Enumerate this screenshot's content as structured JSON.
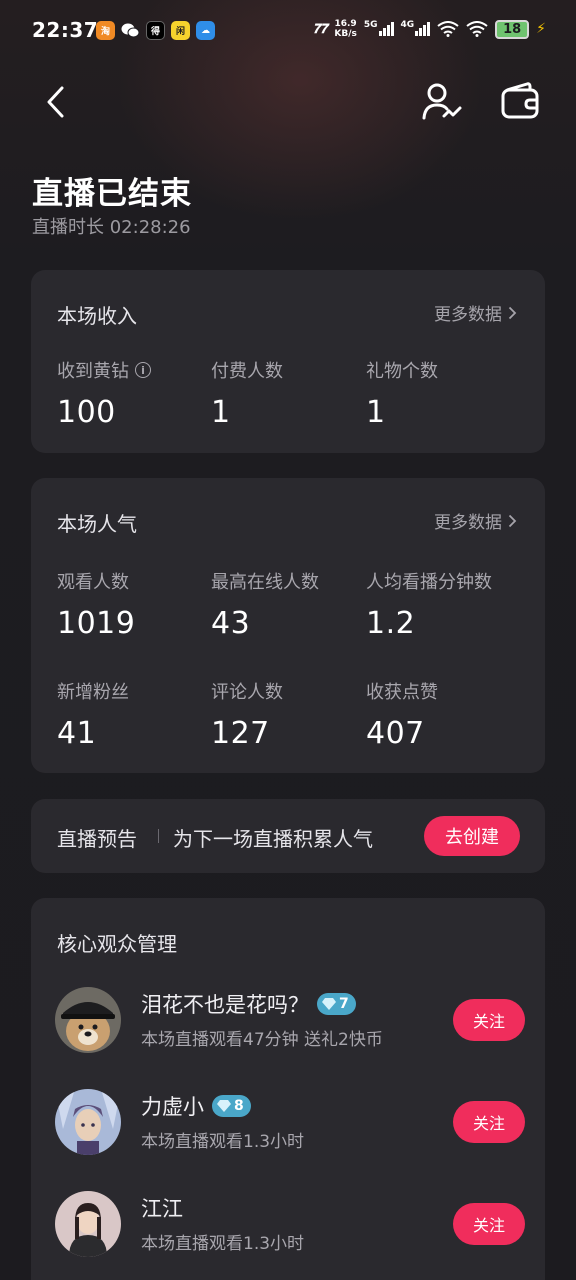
{
  "status_bar": {
    "time": "22:37",
    "net_speed_value": "16.9",
    "net_speed_unit": "KB/s",
    "sim1": "5G",
    "sim2": "4G",
    "battery": "18"
  },
  "header": {
    "title": "直播已结束",
    "duration": "直播时长 02:28:26"
  },
  "income": {
    "title": "本场收入",
    "more": "更多数据",
    "stats": [
      {
        "label": "收到黄钻",
        "value": "100"
      },
      {
        "label": "付费人数",
        "value": "1"
      },
      {
        "label": "礼物个数",
        "value": "1"
      }
    ]
  },
  "popularity": {
    "title": "本场人气",
    "more": "更多数据",
    "stats": [
      {
        "label": "观看人数",
        "value": "1019"
      },
      {
        "label": "最高在线人数",
        "value": "43"
      },
      {
        "label": "人均看播分钟数",
        "value": "1.2"
      },
      {
        "label": "新增粉丝",
        "value": "41"
      },
      {
        "label": "评论人数",
        "value": "127"
      },
      {
        "label": "收获点赞",
        "value": "407"
      }
    ]
  },
  "preview": {
    "label": "直播预告",
    "description": "为下一场直播积累人气",
    "button": "去创建"
  },
  "audience": {
    "title": "核心观众管理",
    "items": [
      {
        "name": "泪花不也是花吗？",
        "level": "7",
        "desc": "本场直播观看47分钟 送礼2快币",
        "follow": "关注"
      },
      {
        "name": "力虚小",
        "level": "8",
        "desc": "本场直播观看1.3小时",
        "follow": "关注"
      },
      {
        "name": "江江",
        "desc": "本场直播观看1.3小时",
        "follow": "关注"
      }
    ]
  },
  "colors": {
    "accent": "#f02d5c",
    "card": "#2a292e",
    "background": "#1c1b1f",
    "badge": "#4aa7c9"
  }
}
